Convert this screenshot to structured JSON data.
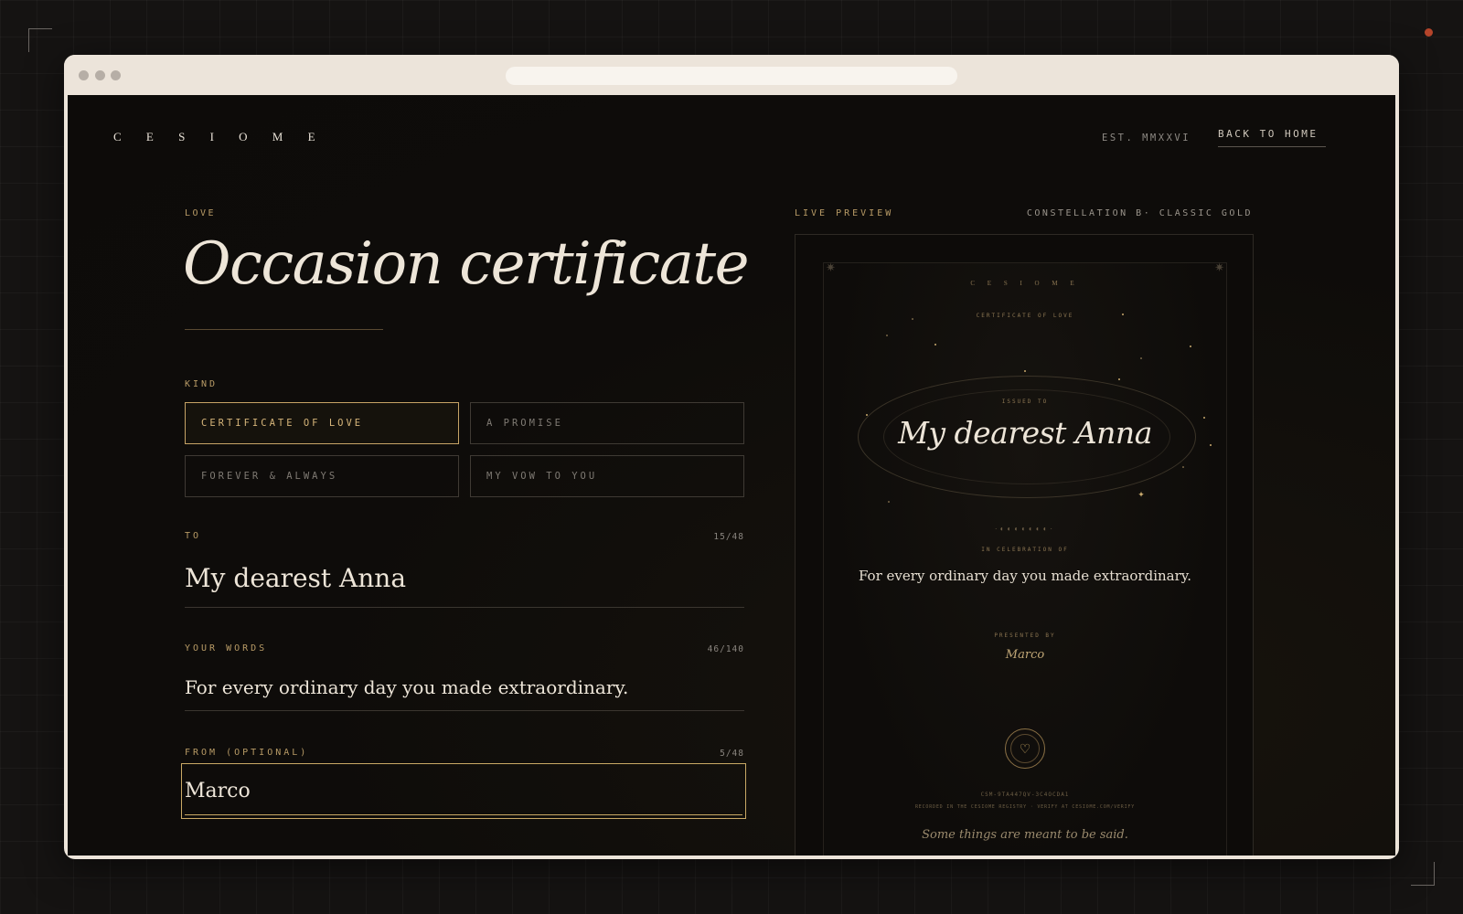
{
  "app": {
    "brand": "C E S I O M E",
    "est": "EST. MMXXVI",
    "back_home": "BACK TO HOME"
  },
  "editor": {
    "eyebrow": "LOVE",
    "title": "Occasion certificate",
    "kind_label": "KIND",
    "kinds": [
      {
        "label": "CERTIFICATE OF LOVE",
        "selected": true
      },
      {
        "label": "A PROMISE",
        "selected": false
      },
      {
        "label": "FOREVER & ALWAYS",
        "selected": false
      },
      {
        "label": "MY VOW TO YOU",
        "selected": false
      }
    ],
    "to": {
      "label": "TO",
      "count": "15/48",
      "value": "My dearest Anna"
    },
    "words": {
      "label": "YOUR WORDS",
      "count": "46/140",
      "value": "For every ordinary day you made extraordinary."
    },
    "from": {
      "label": "FROM (OPTIONAL)",
      "count": "5/48",
      "value": "Marco"
    }
  },
  "preview": {
    "label": "LIVE PREVIEW",
    "theme": "CONSTELLATION B· CLASSIC GOLD",
    "certificate": {
      "brand": "C E S I O M E",
      "kind": "CERTIFICATE OF LOVE",
      "issued_label": "ISSUED TO",
      "recipient": "My dearest Anna",
      "celebration_label": "IN CELEBRATION OF",
      "message": "For every ordinary day you made extraordinary.",
      "presented_label": "PRESENTED BY",
      "sender": "Marco",
      "serial": "CSM-9TA447QV-3C4OCDA1",
      "registry": "RECORDED IN THE CESIOME REGISTRY · VERIFY AT CESIOME.COM/VERIFY",
      "footer": "Some things are meant to be said.",
      "seal_icon": "heart-icon"
    }
  },
  "colors": {
    "accent_gold": "#c9a965",
    "background": "#0e0c0a",
    "text": "#ede5d8"
  }
}
